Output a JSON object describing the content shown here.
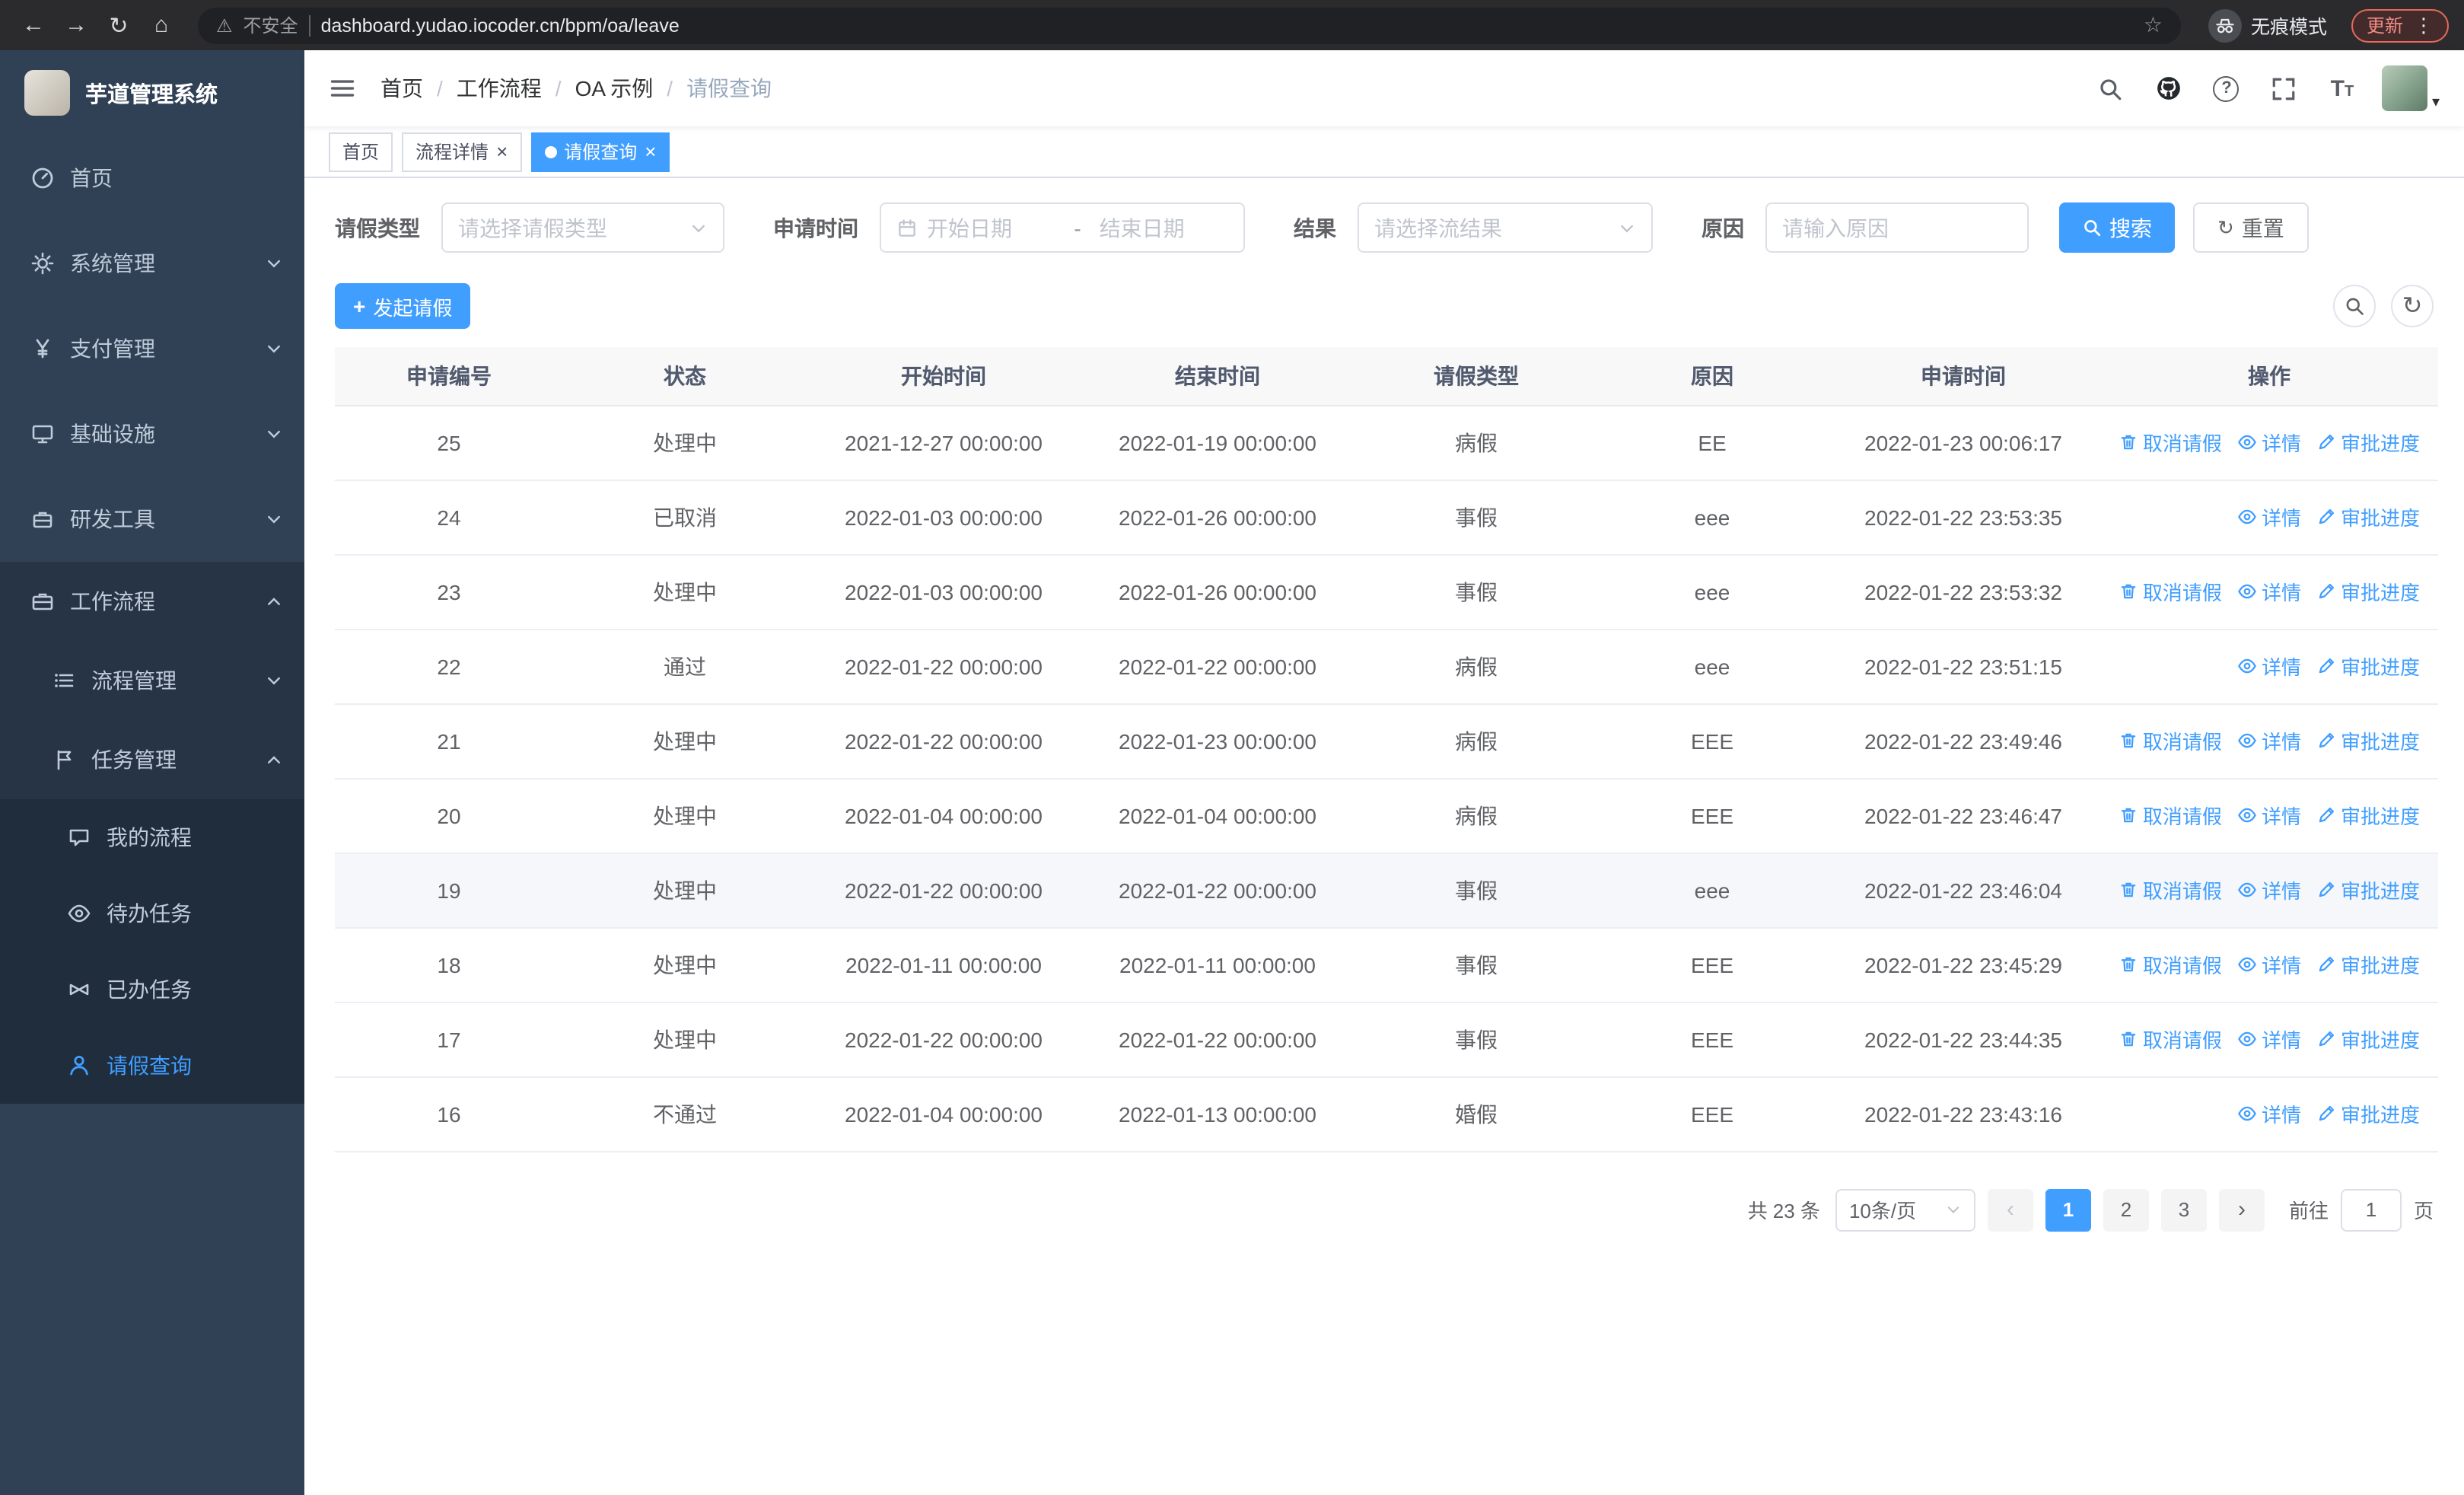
{
  "icons": {
    "back": "←",
    "forward": "→",
    "reload": "↻",
    "home": "⌂",
    "warning": "⚠",
    "star": "☆",
    "kebab": "⋮",
    "close": "×",
    "caret_down": "▾",
    "plus": "+",
    "refresh": "↻",
    "chevron_left": "‹",
    "chevron_right": "›",
    "question": "?"
  },
  "colors": {
    "accent": "#409eff",
    "sidebar_bg": "#304156",
    "danger": "#f28b82"
  },
  "browser": {
    "security_label": "不安全",
    "url": "dashboard.yudao.iocoder.cn/bpm/oa/leave",
    "incognito_label": "无痕模式",
    "update_label": "更新"
  },
  "sidebar": {
    "app_title": "芋道管理系统",
    "items": [
      {
        "label": "首页"
      },
      {
        "label": "系统管理"
      },
      {
        "label": "支付管理"
      },
      {
        "label": "基础设施"
      },
      {
        "label": "研发工具"
      },
      {
        "label": "工作流程"
      }
    ],
    "workflow_children": [
      {
        "label": "流程管理"
      },
      {
        "label": "任务管理"
      }
    ],
    "task_children": [
      {
        "label": "我的流程"
      },
      {
        "label": "待办任务"
      },
      {
        "label": "已办任务"
      },
      {
        "label": "请假查询"
      }
    ]
  },
  "header": {
    "breadcrumb": [
      "首页",
      "工作流程",
      "OA 示例",
      "请假查询"
    ],
    "breadcrumb_separator": "/",
    "font_size_icon_text": "T"
  },
  "tabs": [
    {
      "label": "首页"
    },
    {
      "label": "流程详情"
    },
    {
      "label": "请假查询"
    }
  ],
  "filters": {
    "type_label": "请假类型",
    "type_placeholder": "请选择请假类型",
    "time_label": "申请时间",
    "start_placeholder": "开始日期",
    "range_separator": "-",
    "end_placeholder": "结束日期",
    "result_label": "结果",
    "result_placeholder": "请选择流结果",
    "reason_label": "原因",
    "reason_placeholder": "请输入原因",
    "search_button": "搜索",
    "reset_button": "重置"
  },
  "toolbar": {
    "create_button": "发起请假"
  },
  "table": {
    "columns": [
      "申请编号",
      "状态",
      "开始时间",
      "结束时间",
      "请假类型",
      "原因",
      "申请时间",
      "操作"
    ],
    "op_labels": {
      "cancel": "取消请假",
      "detail": "详情",
      "progress": "审批进度"
    },
    "rows": [
      {
        "id": "25",
        "status": "处理中",
        "start": "2021-12-27 00:00:00",
        "end": "2022-01-19 00:00:00",
        "type": "病假",
        "reason": "EE",
        "applied": "2022-01-23 00:06:17",
        "ops": [
          "cancel",
          "detail",
          "progress"
        ],
        "highlight": false
      },
      {
        "id": "24",
        "status": "已取消",
        "start": "2022-01-03 00:00:00",
        "end": "2022-01-26 00:00:00",
        "type": "事假",
        "reason": "eee",
        "applied": "2022-01-22 23:53:35",
        "ops": [
          "detail",
          "progress"
        ],
        "highlight": false
      },
      {
        "id": "23",
        "status": "处理中",
        "start": "2022-01-03 00:00:00",
        "end": "2022-01-26 00:00:00",
        "type": "事假",
        "reason": "eee",
        "applied": "2022-01-22 23:53:32",
        "ops": [
          "cancel",
          "detail",
          "progress"
        ],
        "highlight": false
      },
      {
        "id": "22",
        "status": "通过",
        "start": "2022-01-22 00:00:00",
        "end": "2022-01-22 00:00:00",
        "type": "病假",
        "reason": "eee",
        "applied": "2022-01-22 23:51:15",
        "ops": [
          "detail",
          "progress"
        ],
        "highlight": false
      },
      {
        "id": "21",
        "status": "处理中",
        "start": "2022-01-22 00:00:00",
        "end": "2022-01-23 00:00:00",
        "type": "病假",
        "reason": "EEE",
        "applied": "2022-01-22 23:49:46",
        "ops": [
          "cancel",
          "detail",
          "progress"
        ],
        "highlight": false
      },
      {
        "id": "20",
        "status": "处理中",
        "start": "2022-01-04 00:00:00",
        "end": "2022-01-04 00:00:00",
        "type": "病假",
        "reason": "EEE",
        "applied": "2022-01-22 23:46:47",
        "ops": [
          "cancel",
          "detail",
          "progress"
        ],
        "highlight": false
      },
      {
        "id": "19",
        "status": "处理中",
        "start": "2022-01-22 00:00:00",
        "end": "2022-01-22 00:00:00",
        "type": "事假",
        "reason": "eee",
        "applied": "2022-01-22 23:46:04",
        "ops": [
          "cancel",
          "detail",
          "progress"
        ],
        "highlight": true
      },
      {
        "id": "18",
        "status": "处理中",
        "start": "2022-01-11 00:00:00",
        "end": "2022-01-11 00:00:00",
        "type": "事假",
        "reason": "EEE",
        "applied": "2022-01-22 23:45:29",
        "ops": [
          "cancel",
          "detail",
          "progress"
        ],
        "highlight": false
      },
      {
        "id": "17",
        "status": "处理中",
        "start": "2022-01-22 00:00:00",
        "end": "2022-01-22 00:00:00",
        "type": "事假",
        "reason": "EEE",
        "applied": "2022-01-22 23:44:35",
        "ops": [
          "cancel",
          "detail",
          "progress"
        ],
        "highlight": false
      },
      {
        "id": "16",
        "status": "不通过",
        "start": "2022-01-04 00:00:00",
        "end": "2022-01-13 00:00:00",
        "type": "婚假",
        "reason": "EEE",
        "applied": "2022-01-22 23:43:16",
        "ops": [
          "detail",
          "progress"
        ],
        "highlight": false
      }
    ]
  },
  "pagination": {
    "total_text": "共 23 条",
    "page_size": "10条/页",
    "pages": [
      "1",
      "2",
      "3"
    ],
    "active_page": "1",
    "jump_prefix": "前往",
    "jump_value": "1",
    "jump_suffix": "页"
  }
}
